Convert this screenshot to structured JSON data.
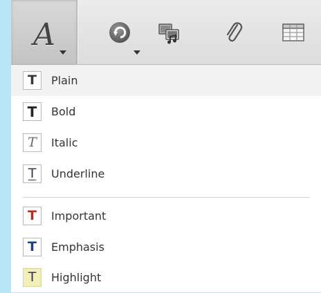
{
  "toolbar": {
    "buttons": [
      {
        "name": "font-style",
        "icon": "font-a-icon",
        "glyph": "A"
      },
      {
        "name": "link",
        "icon": "link-arrow-icon"
      },
      {
        "name": "media",
        "icon": "media-icon"
      },
      {
        "name": "attachment",
        "icon": "paperclip-icon"
      },
      {
        "name": "table",
        "icon": "table-icon"
      }
    ]
  },
  "menu": {
    "items": [
      {
        "label": "Plain",
        "glyph": "T",
        "color": "#2f3a44"
      },
      {
        "label": "Bold",
        "glyph": "T",
        "color": "#1e2630"
      },
      {
        "label": "Italic",
        "glyph": "T",
        "color": "#6a6a6a"
      },
      {
        "label": "Underline",
        "glyph": "T",
        "color": "#2f3a44"
      },
      {
        "label": "Important",
        "glyph": "T",
        "color": "#b52a22"
      },
      {
        "label": "Emphasis",
        "glyph": "T",
        "color": "#1f3f8a"
      },
      {
        "label": "Highlight",
        "glyph": "T",
        "color": "#2f3a44",
        "background": "#f2f0b8"
      }
    ]
  }
}
